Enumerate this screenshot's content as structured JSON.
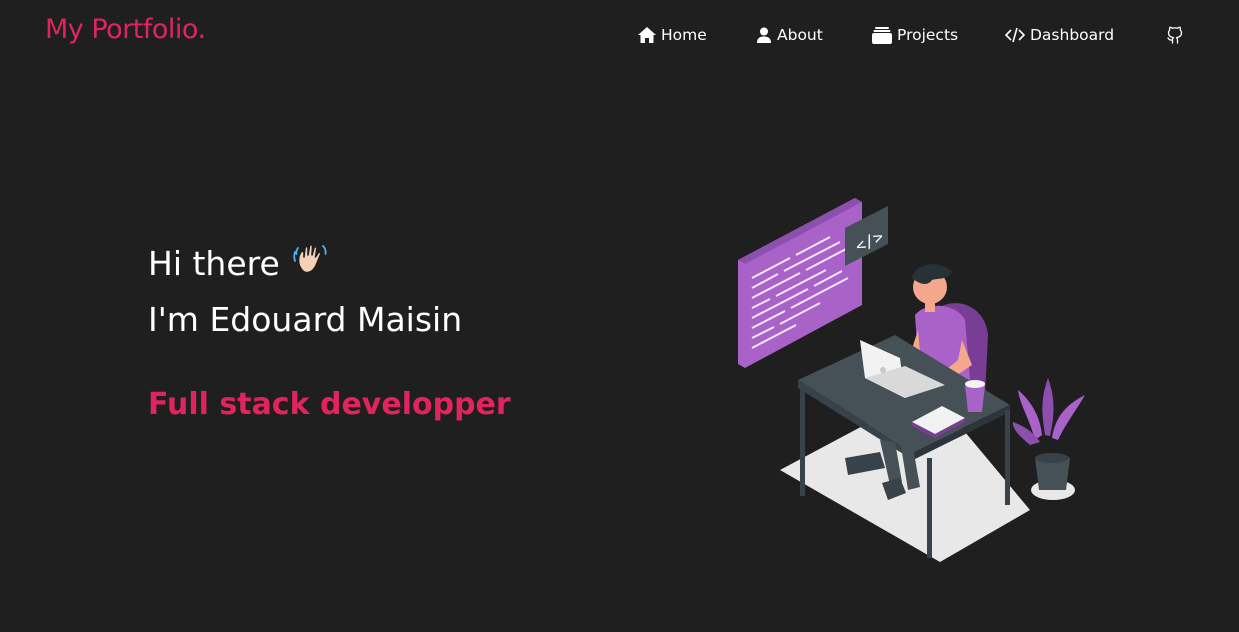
{
  "brand": {
    "name": "My Portfolio.",
    "color": "#e1245f"
  },
  "nav": {
    "items": [
      {
        "label": "Home",
        "icon": "home-icon"
      },
      {
        "label": "About",
        "icon": "user-icon"
      },
      {
        "label": "Projects",
        "icon": "folder-icon"
      },
      {
        "label": "Dashboard",
        "icon": "code-icon"
      }
    ],
    "github_icon": "github-icon"
  },
  "hero": {
    "greeting": "Hi there",
    "greeting_emoji": "👋🏻",
    "name_line": "I'm Edouard Maisin",
    "role": "Full stack developper"
  },
  "illustration": {
    "screen_tag": "</>",
    "accent": "#a862c8"
  },
  "colors": {
    "background": "#1f1f1f",
    "accent": "#e1245f",
    "text": "#ffffff"
  }
}
